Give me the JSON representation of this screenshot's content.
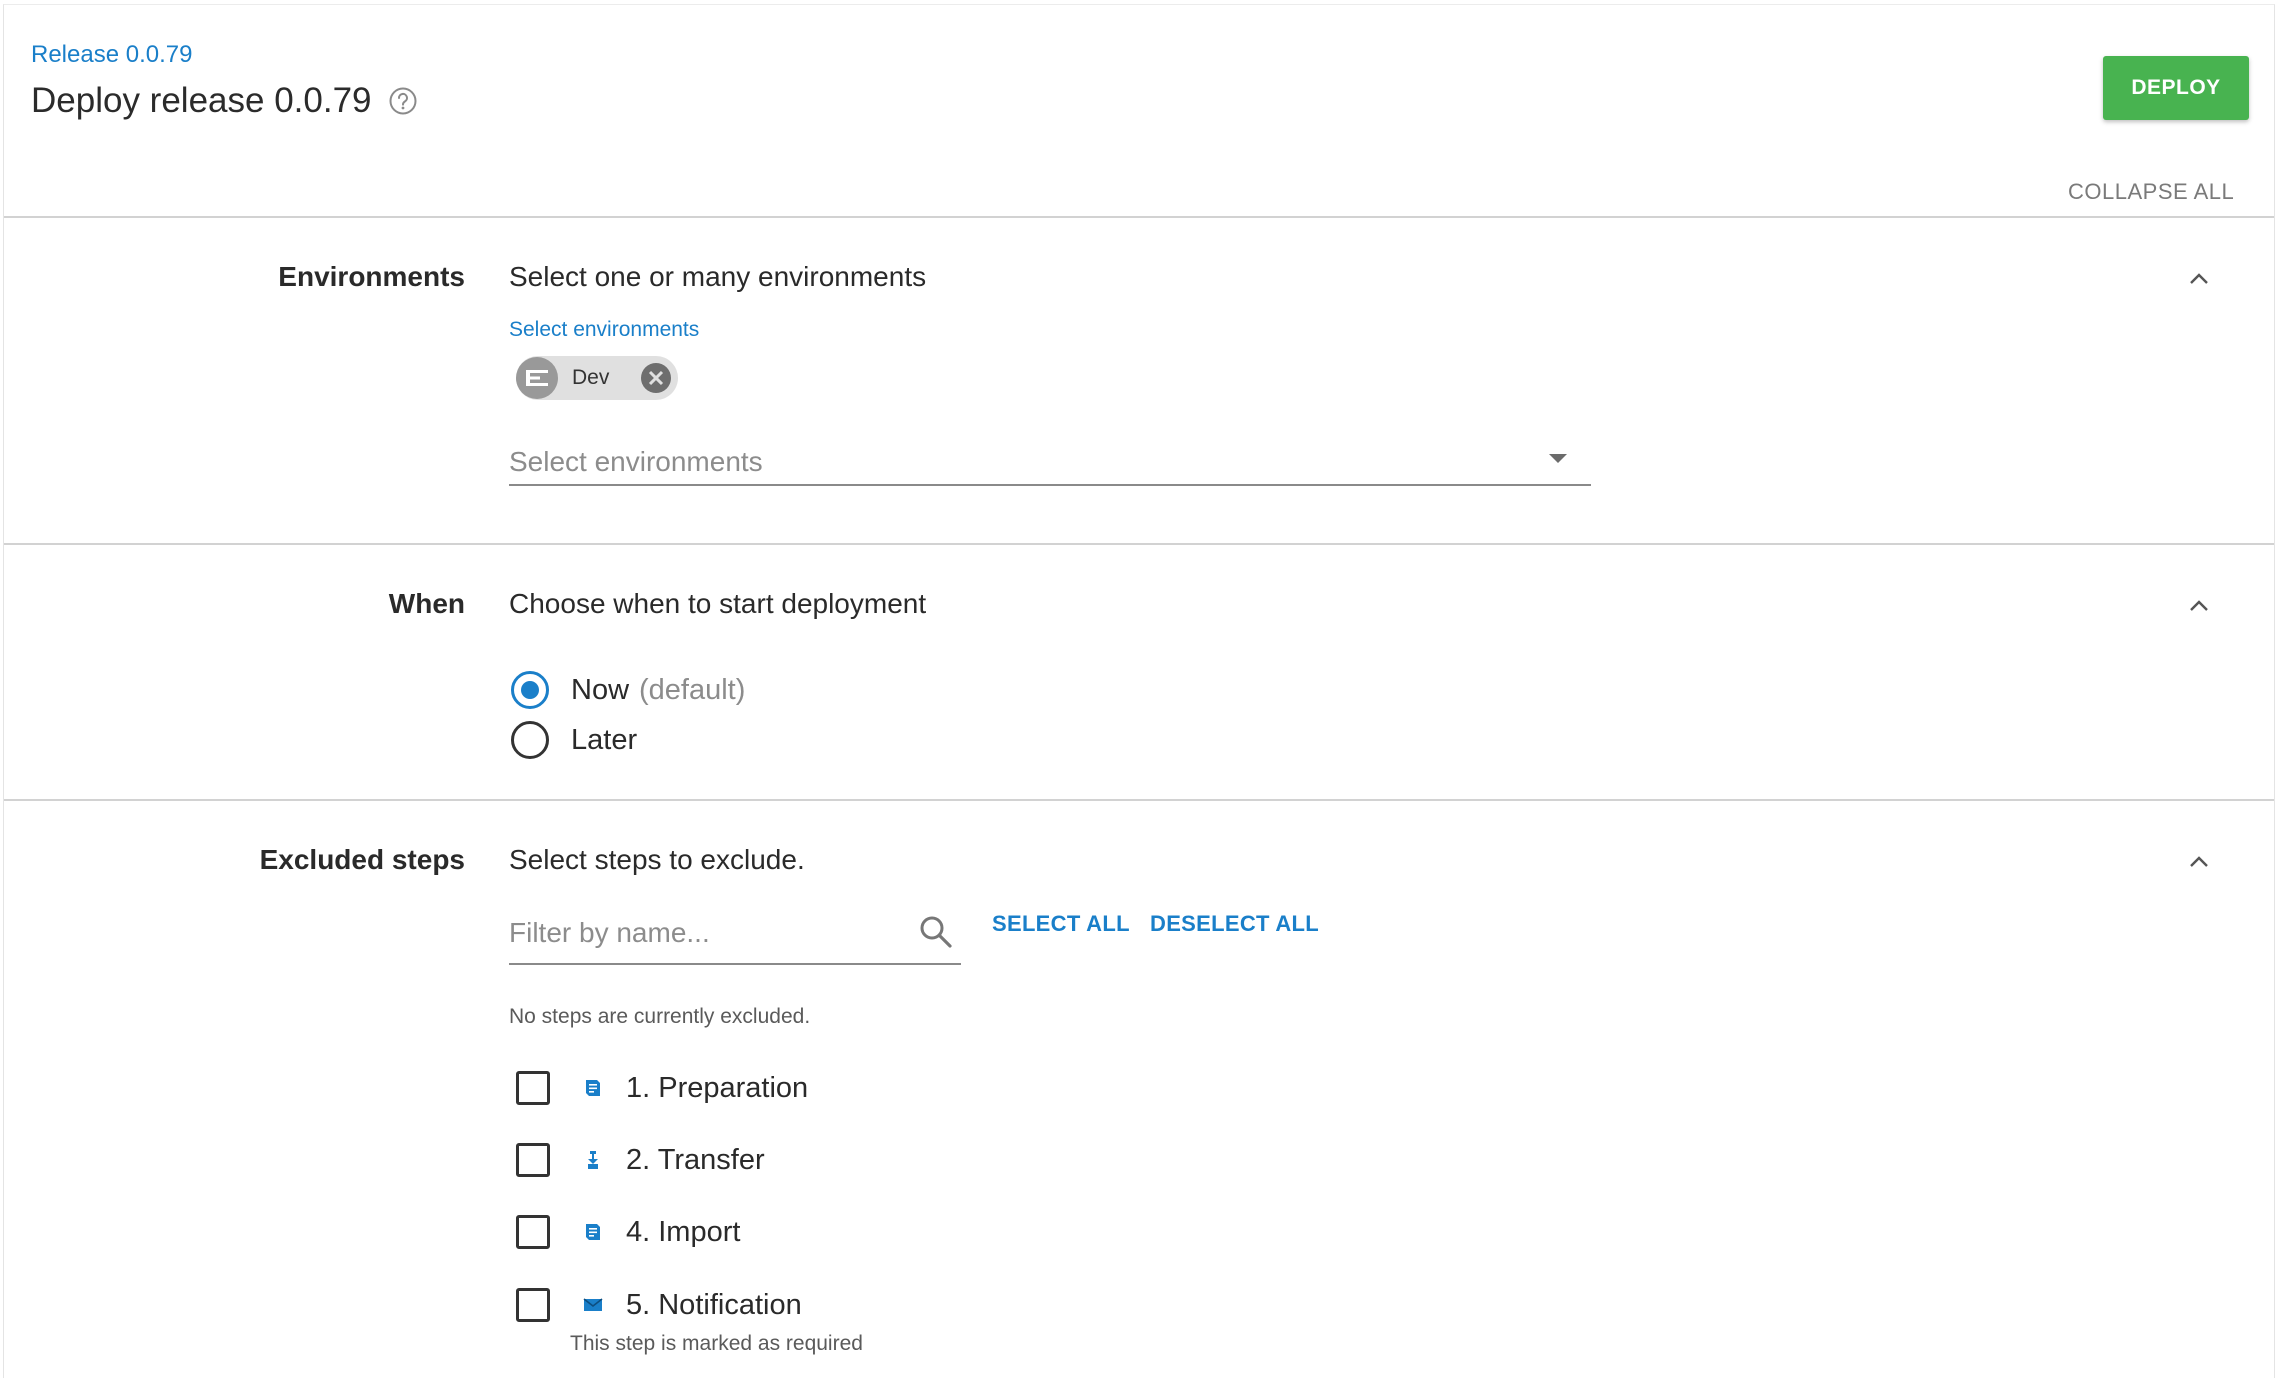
{
  "header": {
    "breadcrumb": "Release 0.0.79",
    "title": "Deploy release 0.0.79",
    "help_icon": "help-circle-icon",
    "deploy_label": "DEPLOY",
    "collapse_all_label": "COLLAPSE ALL"
  },
  "environments": {
    "label": "Environments",
    "description": "Select one or many environments",
    "field_label": "Select environments",
    "chips": [
      {
        "label": "Dev",
        "icon": "environment-icon"
      }
    ],
    "placeholder": "Select environments"
  },
  "when": {
    "label": "When",
    "description": "Choose when to start deployment",
    "options": [
      {
        "label": "Now",
        "hint": "(default)",
        "selected": true
      },
      {
        "label": "Later",
        "hint": "",
        "selected": false
      }
    ]
  },
  "excluded_steps": {
    "label": "Excluded steps",
    "description": "Select steps to exclude.",
    "filter_placeholder": "Filter by name...",
    "select_all_label": "SELECT ALL",
    "deselect_all_label": "DESELECT ALL",
    "status_text": "No steps are currently excluded.",
    "steps": [
      {
        "label": "1. Preparation",
        "icon": "script-step-icon",
        "checked": false
      },
      {
        "label": "2. Transfer",
        "icon": "transfer-step-icon",
        "checked": false
      },
      {
        "label": "4. Import",
        "icon": "script-step-icon",
        "checked": false
      },
      {
        "label": "5. Notification",
        "icon": "email-step-icon",
        "checked": false
      }
    ],
    "required_note": "This step is marked as required"
  },
  "colors": {
    "accent": "#1a7fc9",
    "deploy_button": "#48b350",
    "divider": "#d2d2d2"
  }
}
